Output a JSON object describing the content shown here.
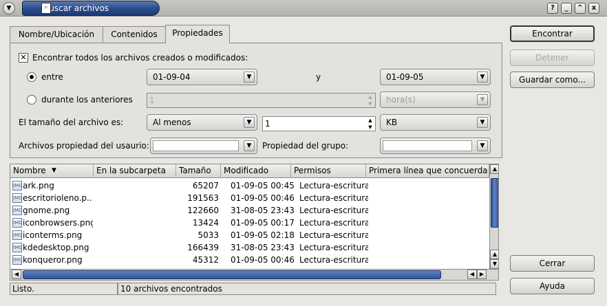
{
  "window": {
    "title": "Buscar archivos",
    "controls": [
      "?",
      "_",
      "^",
      "x"
    ]
  },
  "tabs": [
    {
      "label": "Nombre/Ubicación",
      "active": false
    },
    {
      "label": "Contenidos",
      "active": false
    },
    {
      "label": "Propiedades",
      "active": true
    }
  ],
  "properties": {
    "find_created_modified_label": "Encontrar todos los archivos creados o modificados:",
    "find_created_modified_checked": true,
    "between_label": "entre",
    "between_selected": true,
    "date_from": "01-09-04",
    "and_label": "y",
    "date_to": "01-09-05",
    "during_label": "durante los anteriores",
    "during_value": "1",
    "during_unit": "hora(s)",
    "size_label": "El tamaño del archivo es:",
    "size_mode": "Al menos",
    "size_value": "1",
    "size_unit": "KB",
    "owner_user_label": "Archivos propiedad del usaurio:",
    "owner_user_value": "",
    "owner_group_label": "Propiedad del grupo:",
    "owner_group_value": ""
  },
  "buttons": {
    "find": "Encontrar",
    "stop": "Detener",
    "save_as": "Guardar como...",
    "close": "Cerrar",
    "help": "Ayuda"
  },
  "results": {
    "columns": [
      "Nombre",
      "En la subcarpeta",
      "Tamaño",
      "Modificado",
      "Permisos",
      "Primera línea que concuerda"
    ],
    "rows": [
      {
        "name": "ark.png",
        "subfolder": "",
        "size": "65207",
        "modified": "01-09-05 00:45",
        "permissions": "Lectura-escritura"
      },
      {
        "name": "escritorioleno.p...",
        "subfolder": "",
        "size": "191563",
        "modified": "01-09-05 00:46",
        "permissions": "Lectura-escritura"
      },
      {
        "name": "gnome.png",
        "subfolder": "",
        "size": "122660",
        "modified": "31-08-05 23:43",
        "permissions": "Lectura-escritura"
      },
      {
        "name": "iconbrowsers.png",
        "subfolder": "",
        "size": "13424",
        "modified": "01-09-05 00:17",
        "permissions": "Lectura-escritura"
      },
      {
        "name": "iconterms.png",
        "subfolder": "",
        "size": "5033",
        "modified": "01-09-05 02:18",
        "permissions": "Lectura-escritura"
      },
      {
        "name": "kdedesktop.png",
        "subfolder": "",
        "size": "166439",
        "modified": "31-08-05 23:43",
        "permissions": "Lectura-escritura"
      },
      {
        "name": "konqueror.png",
        "subfolder": "",
        "size": "45312",
        "modified": "01-09-05 00:46",
        "permissions": "Lectura-escritura"
      }
    ]
  },
  "status": {
    "state": "Listo.",
    "found": "10 archivos encontrados"
  }
}
